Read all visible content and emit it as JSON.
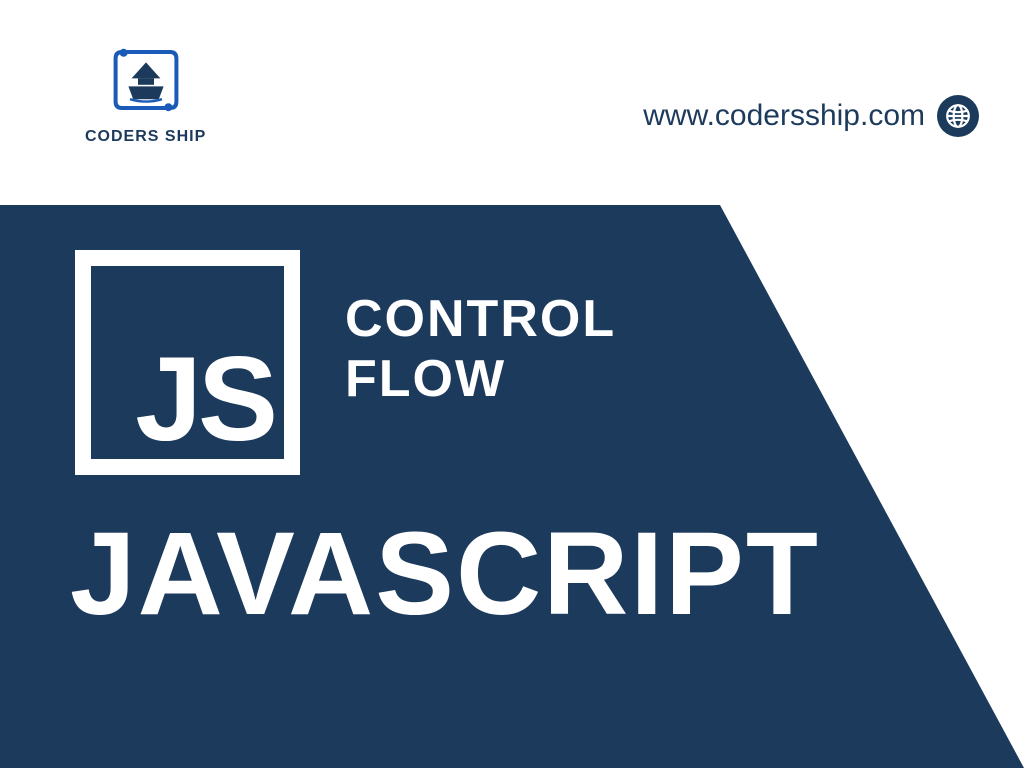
{
  "colors": {
    "brand_dark": "#1c3a5b",
    "white": "#ffffff"
  },
  "header": {
    "logo_text": "CODERS SHIP",
    "url": "www.codersship.com"
  },
  "hero": {
    "js_badge": "JS",
    "topic_line1": "CONTROL",
    "topic_line2": "FLOW",
    "language": "JAVASCRIPT"
  }
}
